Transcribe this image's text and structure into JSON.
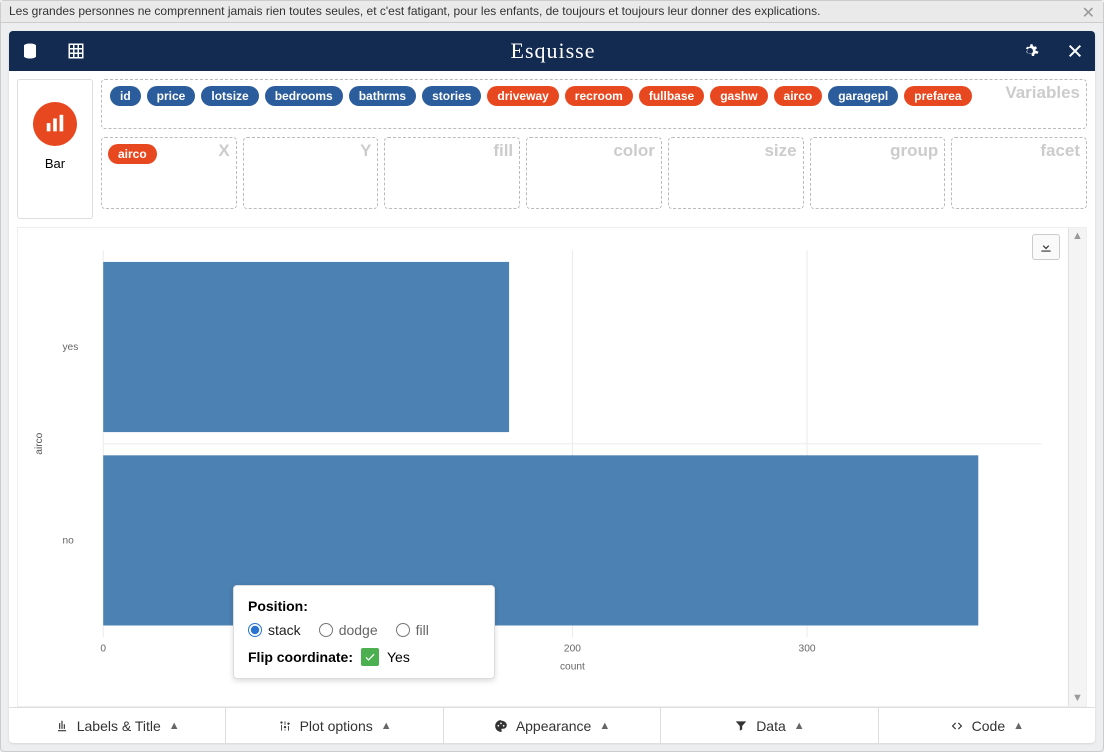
{
  "banner": {
    "text": "Les grandes personnes ne comprennent jamais rien toutes seules, et c'est fatigant, pour les enfants, de toujours et toujours leur donner des explications."
  },
  "app_title": "Esquisse",
  "chart_type": {
    "label": "Bar"
  },
  "variables_watermark": "Variables",
  "variables": [
    {
      "name": "id",
      "kind": "blue"
    },
    {
      "name": "price",
      "kind": "blue"
    },
    {
      "name": "lotsize",
      "kind": "blue"
    },
    {
      "name": "bedrooms",
      "kind": "blue"
    },
    {
      "name": "bathrms",
      "kind": "blue"
    },
    {
      "name": "stories",
      "kind": "blue"
    },
    {
      "name": "driveway",
      "kind": "orange"
    },
    {
      "name": "recroom",
      "kind": "orange"
    },
    {
      "name": "fullbase",
      "kind": "orange"
    },
    {
      "name": "gashw",
      "kind": "orange"
    },
    {
      "name": "airco",
      "kind": "orange"
    },
    {
      "name": "garagepl",
      "kind": "blue"
    },
    {
      "name": "prefarea",
      "kind": "orange"
    }
  ],
  "dropzones": [
    {
      "label": "X",
      "pills": [
        {
          "name": "airco",
          "kind": "orange"
        }
      ]
    },
    {
      "label": "Y",
      "pills": []
    },
    {
      "label": "fill",
      "pills": []
    },
    {
      "label": "color",
      "pills": []
    },
    {
      "label": "size",
      "pills": []
    },
    {
      "label": "group",
      "pills": []
    },
    {
      "label": "facet",
      "pills": []
    }
  ],
  "popup": {
    "position_title": "Position:",
    "options": {
      "stack": "stack",
      "dodge": "dodge",
      "fill": "fill"
    },
    "selected": "stack",
    "flip_label": "Flip coordinate:",
    "flip_value": "Yes"
  },
  "bottom_tabs": {
    "labels_title": "Labels & Title",
    "plot_options": "Plot options",
    "appearance": "Appearance",
    "data": "Data",
    "code": "Code"
  },
  "chart_data": {
    "type": "bar",
    "orientation": "horizontal",
    "categories": [
      "yes",
      "no"
    ],
    "values": [
      173,
      373
    ],
    "xlabel": "count",
    "ylabel": "airco",
    "xlim": [
      0,
      400
    ],
    "x_ticks": [
      0,
      200,
      300
    ],
    "bar_color": "#4b81b3"
  }
}
